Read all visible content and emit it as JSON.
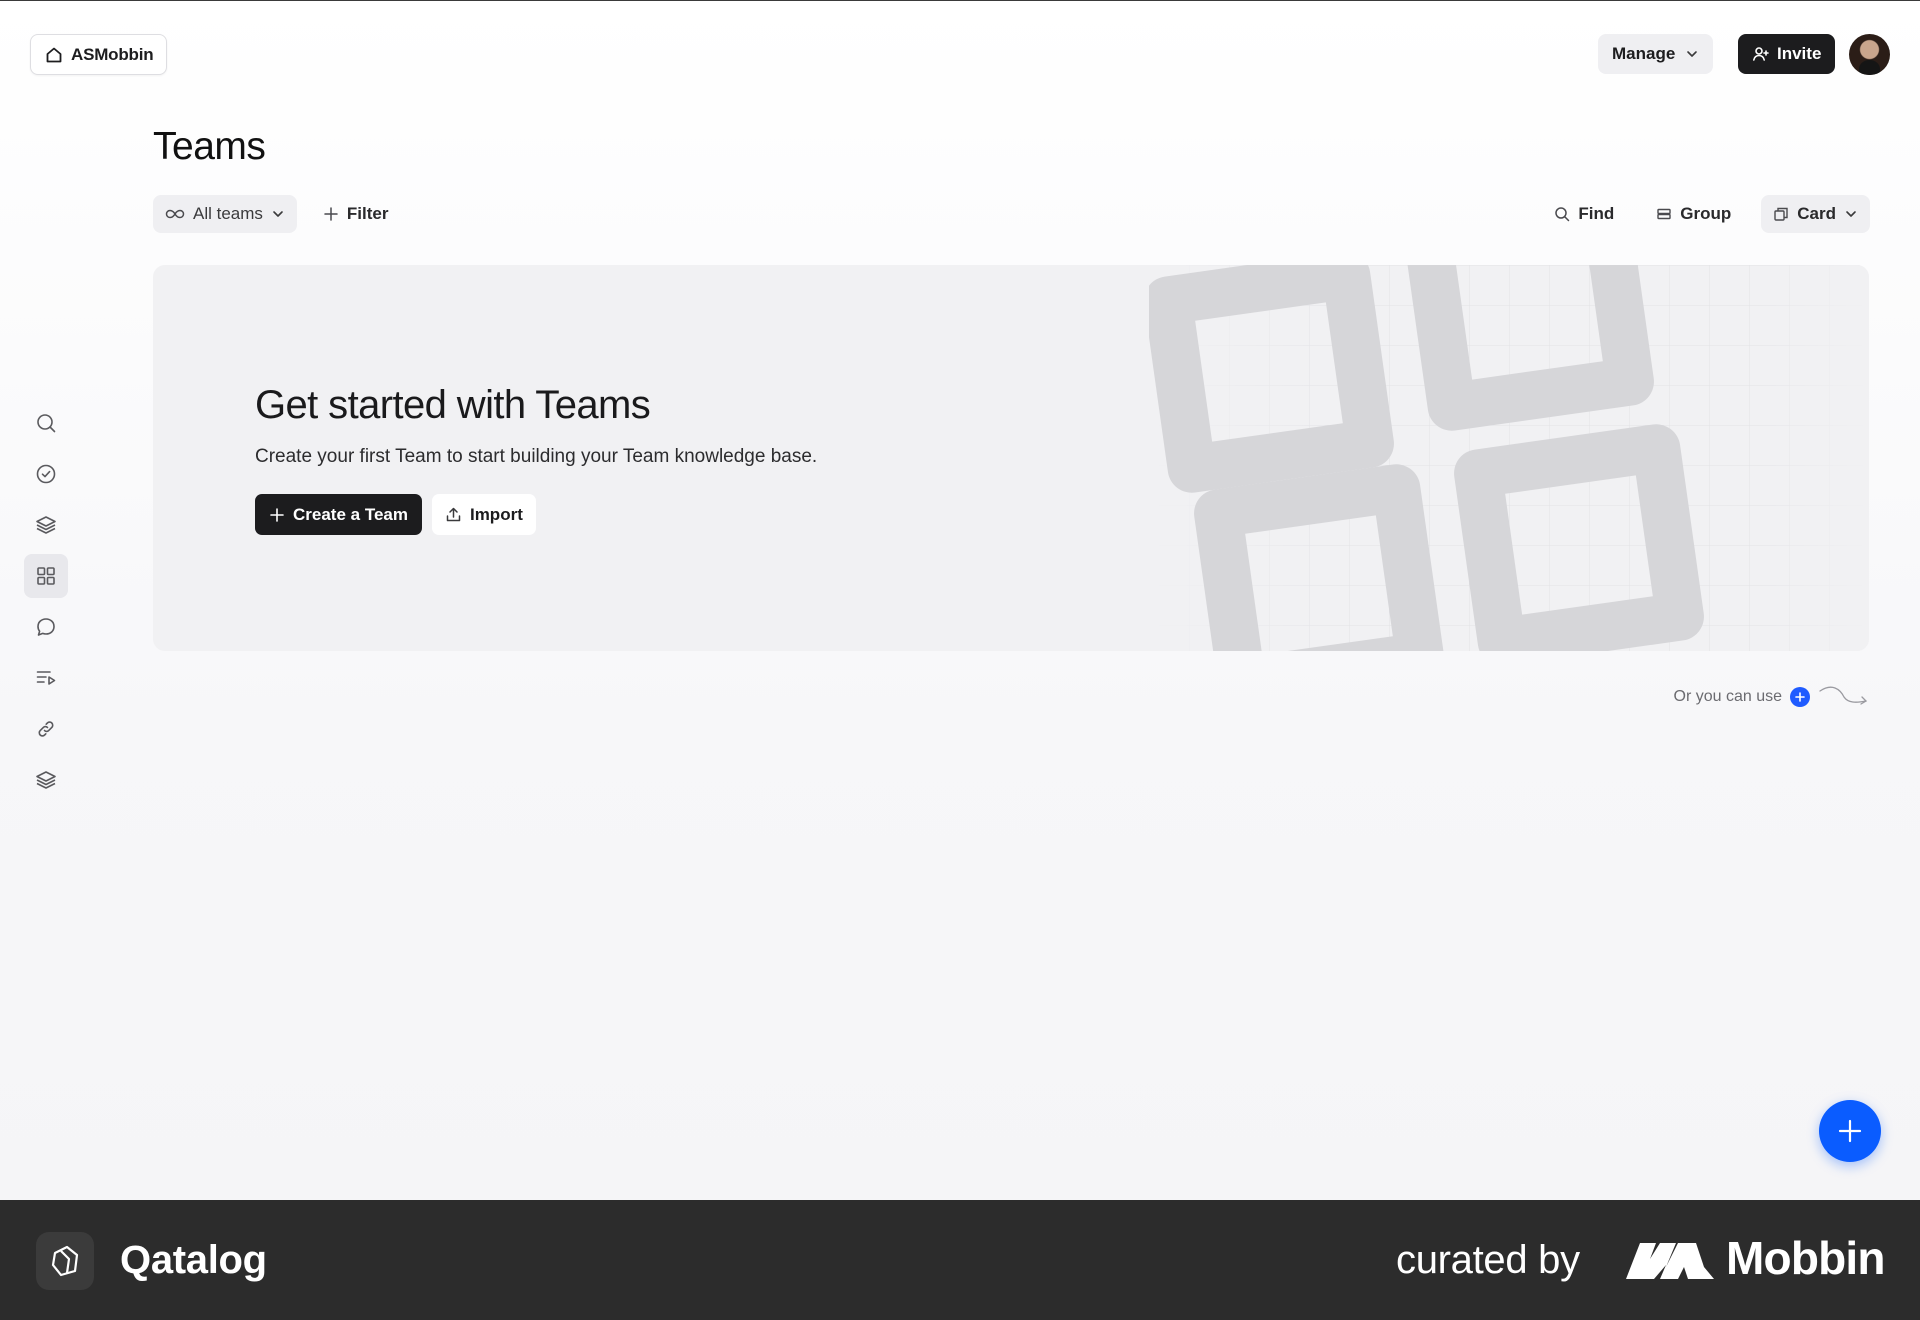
{
  "workspace": {
    "name": "ASMobbin",
    "icon": "home-icon"
  },
  "header": {
    "manage_label": "Manage",
    "invite_label": "Invite"
  },
  "page": {
    "title": "Teams"
  },
  "toolbar": {
    "all_teams_label": "All teams",
    "filter_label": "Filter",
    "find_label": "Find",
    "group_label": "Group",
    "view_label": "Card"
  },
  "sidebar": {
    "items": [
      {
        "icon": "search-icon",
        "active": false
      },
      {
        "icon": "check-circle-icon",
        "active": false
      },
      {
        "icon": "layers-icon",
        "active": false
      },
      {
        "icon": "grid-icon",
        "active": true
      },
      {
        "icon": "chat-bubble-icon",
        "active": false
      },
      {
        "icon": "playlist-icon",
        "active": false
      },
      {
        "icon": "link-icon",
        "active": false
      },
      {
        "icon": "layers-icon",
        "active": false
      }
    ]
  },
  "hero": {
    "title": "Get started with Teams",
    "subtitle": "Create your first Team to start building your Team knowledge base.",
    "primary_label": "Create a Team",
    "secondary_label": "Import"
  },
  "hint": {
    "text": "Or you can use"
  },
  "footer": {
    "app_name": "Qatalog",
    "curated_by": "curated by",
    "brand": "Mobbin"
  },
  "colors": {
    "accent": "#0a5cff",
    "dark_button": "#1c1c1e",
    "footer_bg": "#2c2c2c"
  }
}
